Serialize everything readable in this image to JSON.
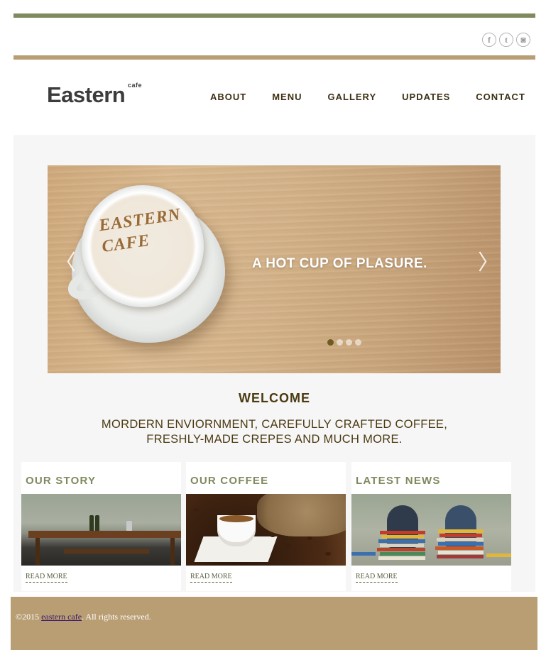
{
  "header": {
    "social": [
      {
        "icon": "facebook-icon",
        "glyph": "f"
      },
      {
        "icon": "twitter-icon",
        "glyph": "t"
      },
      {
        "icon": "instagram-icon",
        "glyph": "◙"
      }
    ],
    "logo": {
      "main": "Eastern",
      "sub": "cafe"
    },
    "nav": [
      "ABOUT",
      "MENU",
      "GALLERY",
      "UPDATES",
      "CONTACT"
    ]
  },
  "slider": {
    "latte_art": "EASTERN CAFE",
    "caption": "A HOT CUP OF PLASURE.",
    "prev_glyph": "〈",
    "next_glyph": "〉",
    "slide_count": 4,
    "active_slide": 1
  },
  "welcome": {
    "title": "WELCOME",
    "line1": "MORDERN ENVIORNMENT, CAREFULLY CRAFTED COFFEE,",
    "line2": "FRESHLY-MADE CREPES AND MUCH MORE."
  },
  "cards": [
    {
      "title": "OUR STORY",
      "link": "READ MORE"
    },
    {
      "title": "OUR COFFEE",
      "link": "READ MORE"
    },
    {
      "title": "LATEST NEWS",
      "link": "READ MORE"
    }
  ],
  "footer": {
    "prefix": "©2015 ",
    "link": "eastern cafe",
    "suffix": ". All rights reserved."
  },
  "colors": {
    "accent_green": "#7f8a5e",
    "accent_tan": "#b99e74",
    "text_brown": "#4b3a12"
  }
}
